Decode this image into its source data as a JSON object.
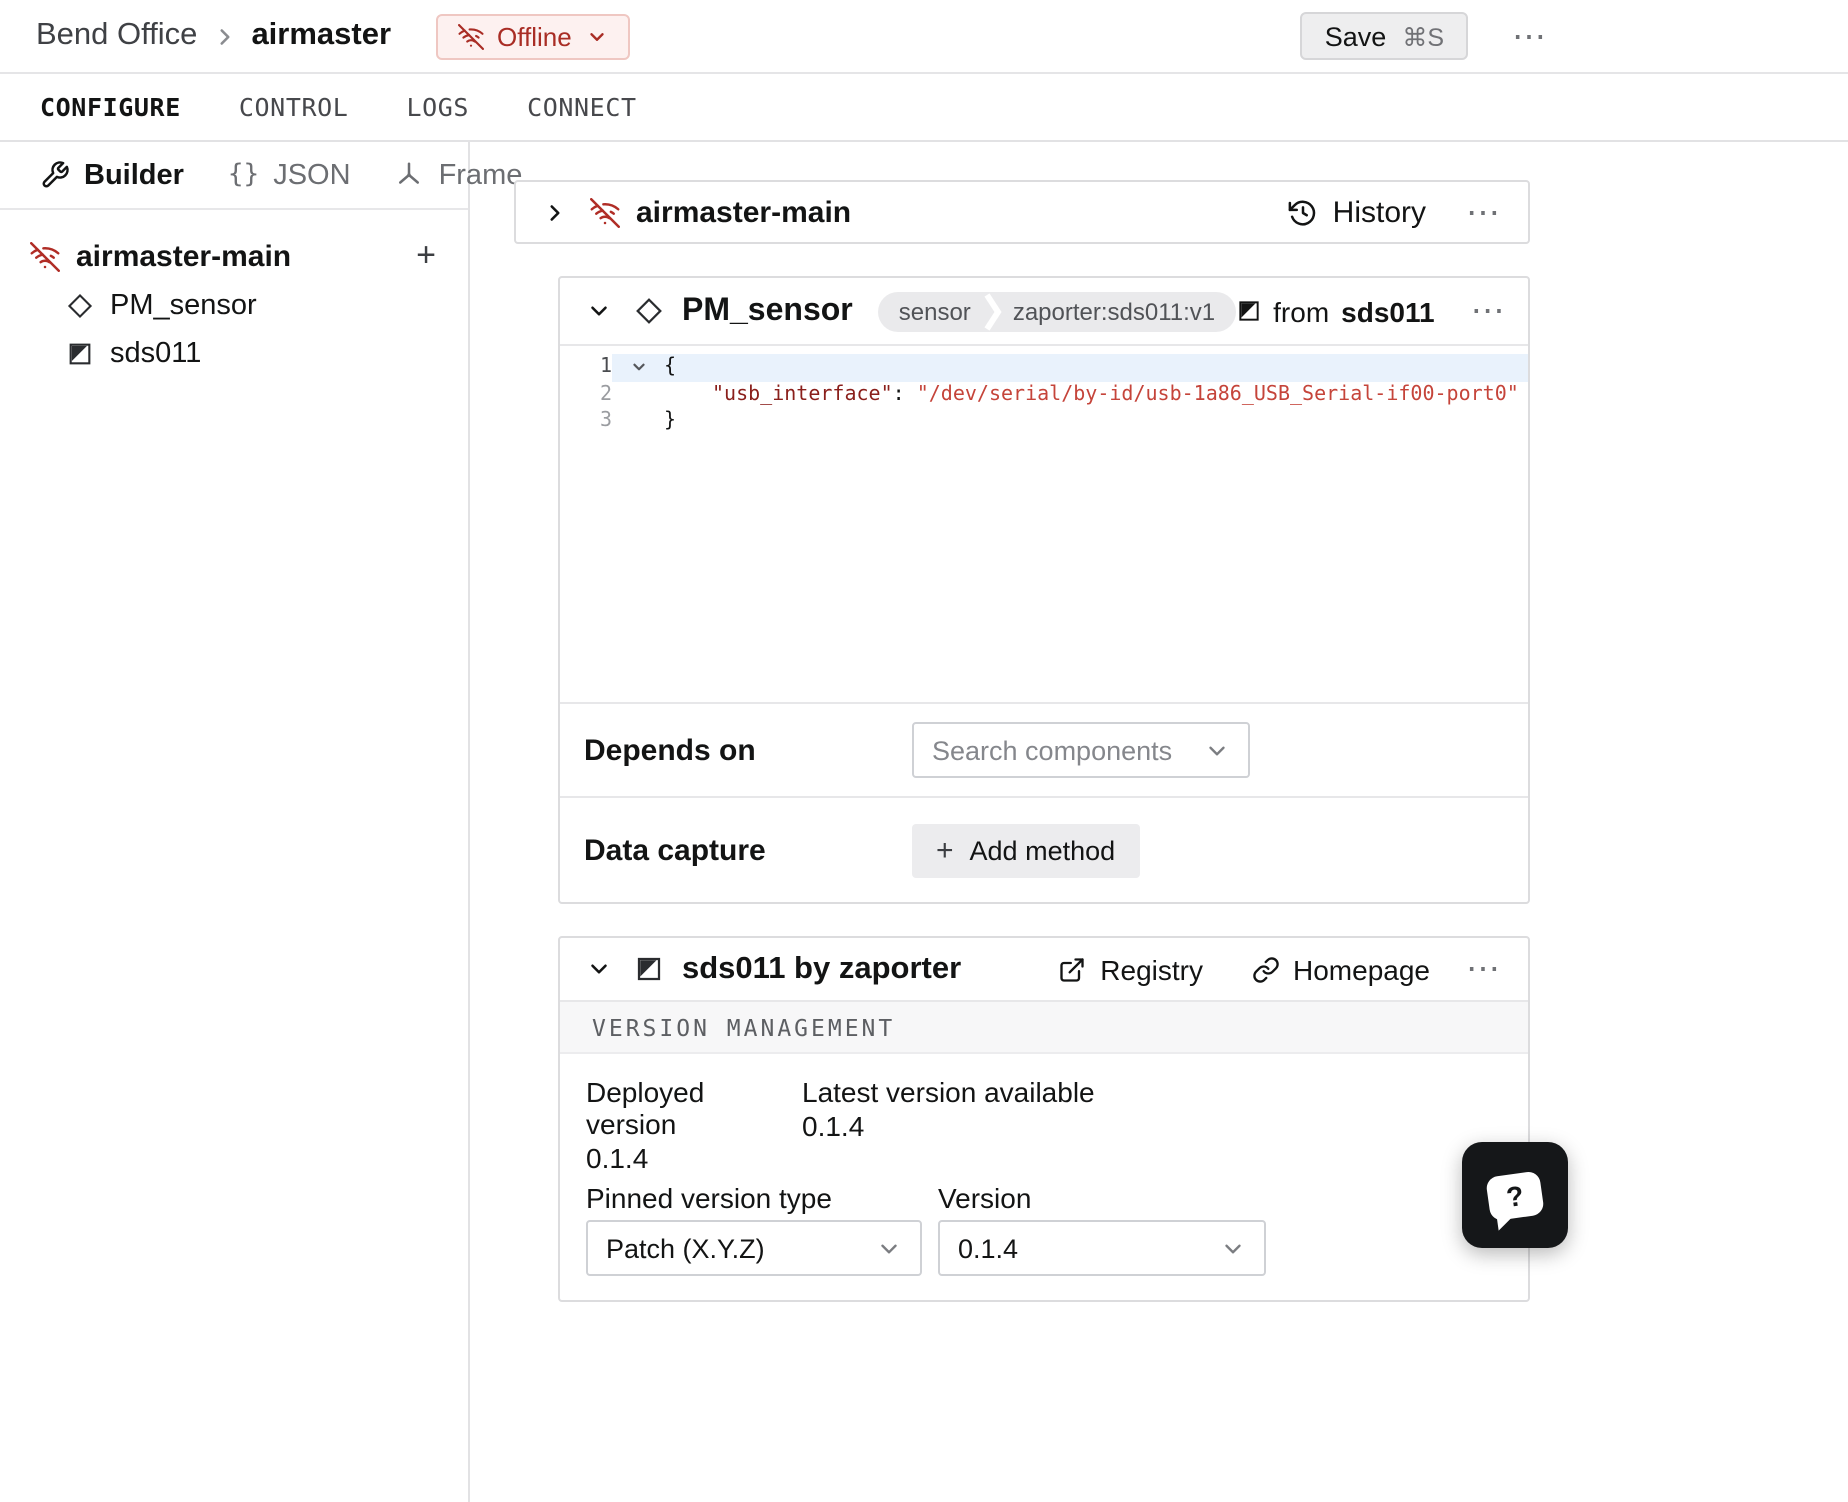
{
  "icons": {
    "overflow": "⋯",
    "plus": "+",
    "braces": "{}"
  },
  "colors": {
    "accent_red": "#b02d26",
    "offline_bg": "#fdf1f0",
    "offline_border": "#efc7c2",
    "active_line_bg": "#e9f2fc",
    "code_key": "#8a1f1b",
    "code_string": "#c5443a"
  },
  "topbar": {
    "location": "Bend Office",
    "machine": "airmaster",
    "status": "Offline",
    "save_label": "Save",
    "save_shortcut": "⌘S"
  },
  "tabs": [
    {
      "label": "CONFIGURE"
    },
    {
      "label": "CONTROL"
    },
    {
      "label": "LOGS"
    },
    {
      "label": "CONNECT"
    }
  ],
  "sidebar": {
    "modes": [
      {
        "label": "Builder"
      },
      {
        "label": "JSON"
      },
      {
        "label": "Frame"
      }
    ],
    "tree": {
      "root": "airmaster-main",
      "children": [
        {
          "label": "PM_sensor"
        },
        {
          "label": "sds011"
        }
      ]
    }
  },
  "machine_card": {
    "title": "airmaster-main",
    "history": "History"
  },
  "component_card": {
    "title": "PM_sensor",
    "type_badge": "sensor",
    "model_badge": "zaporter:sds011:v1",
    "from_prefix": "from",
    "from_module": "sds011",
    "depends_on": {
      "label": "Depends on",
      "placeholder": "Search components"
    },
    "data_capture": {
      "label": "Data capture",
      "button": "Add method"
    }
  },
  "code": {
    "l1": {
      "num": "1",
      "text": "{"
    },
    "l2": {
      "num": "2",
      "key": "\"usb_interface\"",
      "colon": ": ",
      "value": "\"/dev/serial/by-id/usb-1a86_USB_Serial-if00-port0\""
    },
    "l3": {
      "num": "3",
      "text": "}"
    }
  },
  "module_card": {
    "title": "sds011 by zaporter",
    "registry": "Registry",
    "homepage": "Homepage",
    "section": "VERSION MANAGEMENT",
    "deployed_label": "Deployed version",
    "deployed_value": "0.1.4",
    "latest_label": "Latest version available",
    "latest_value": "0.1.4",
    "pinned_label": "Pinned version type",
    "pinned_value": "Patch (X.Y.Z)",
    "version_label": "Version",
    "version_value": "0.1.4"
  },
  "help": {
    "glyph": "?"
  }
}
